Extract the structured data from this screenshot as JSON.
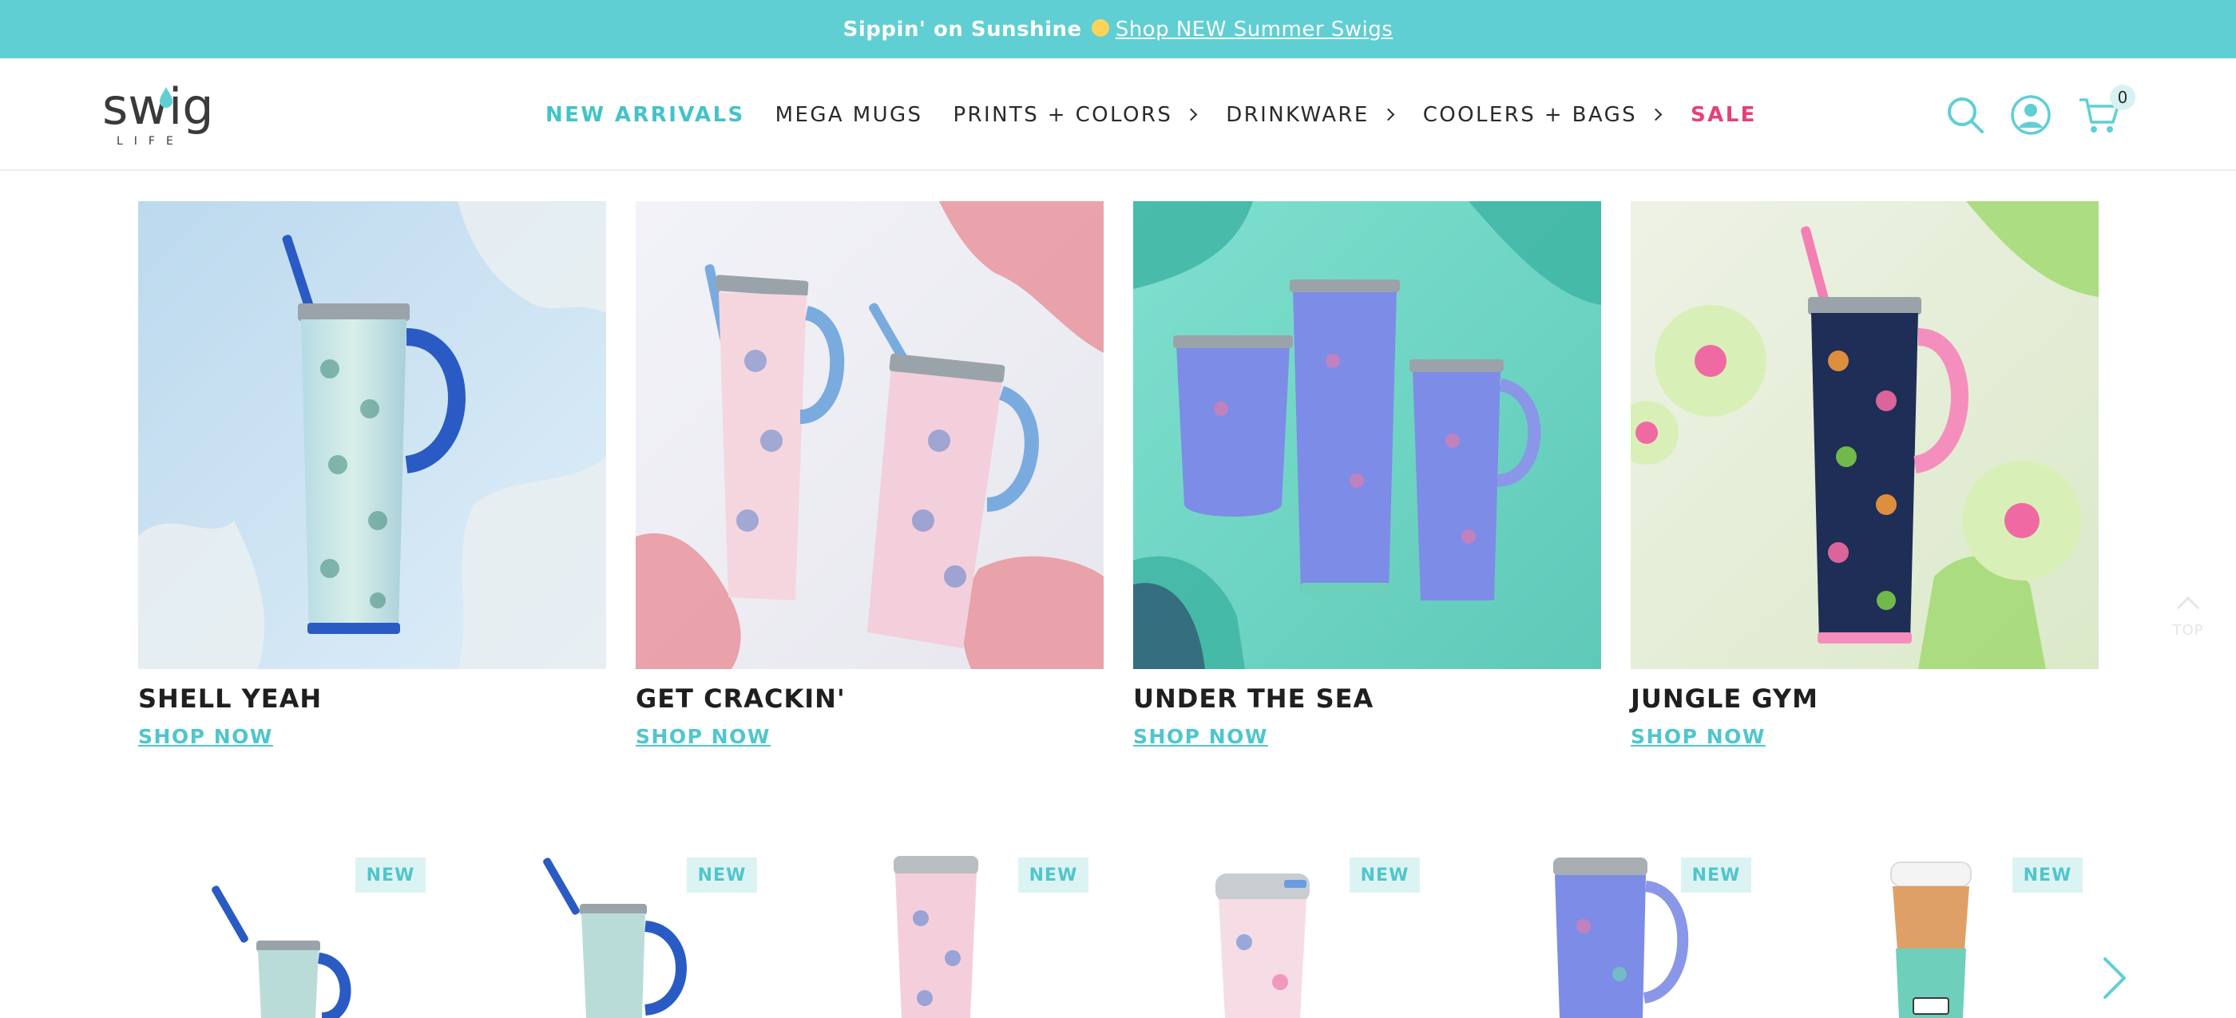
{
  "announcement": {
    "text": "Sippin' on Sunshine",
    "link": "Shop NEW Summer Swigs"
  },
  "brand": {
    "logo_main": "swig",
    "logo_sub": "LIFE"
  },
  "nav": {
    "items": [
      {
        "label": "NEW ARRIVALS"
      },
      {
        "label": "MEGA MUGS"
      },
      {
        "label": "PRINTS + COLORS"
      },
      {
        "label": "DRINKWARE"
      },
      {
        "label": "COOLERS + BAGS"
      },
      {
        "label": "SALE"
      }
    ]
  },
  "header_icons": {
    "search": "search-icon",
    "account": "user-icon",
    "cart": "cart-icon",
    "cart_count": "0"
  },
  "collections": [
    {
      "title": "SHELL YEAH",
      "cta": "SHOP NOW"
    },
    {
      "title": "GET CRACKIN'",
      "cta": "SHOP NOW"
    },
    {
      "title": "UNDER THE SEA",
      "cta": "SHOP NOW"
    },
    {
      "title": "JUNGLE GYM",
      "cta": "SHOP NOW"
    }
  ],
  "products": [
    {
      "badge": "NEW"
    },
    {
      "badge": "NEW"
    },
    {
      "badge": "NEW"
    },
    {
      "badge": "NEW"
    },
    {
      "badge": "NEW"
    },
    {
      "badge": "NEW"
    }
  ],
  "back_to_top": "TOP",
  "colors": {
    "accent": "#5fcfd4",
    "sale": "#e5407a"
  }
}
